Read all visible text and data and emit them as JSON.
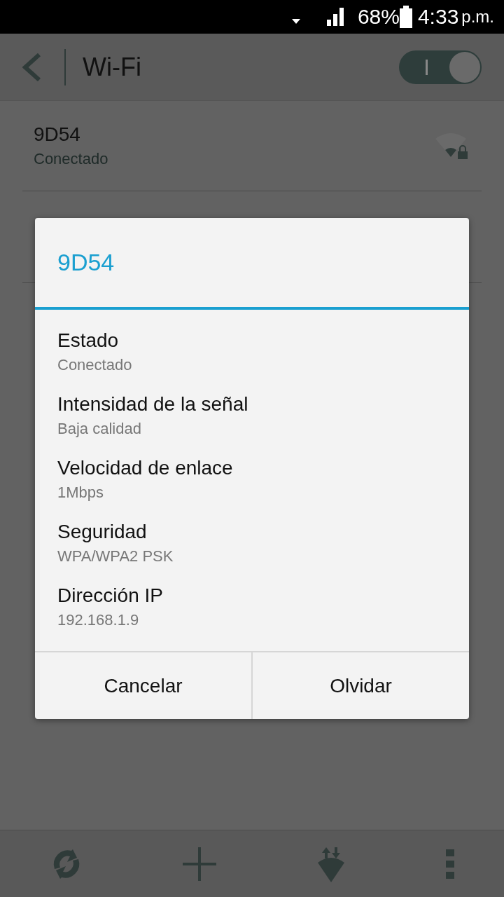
{
  "status_bar": {
    "battery": "68%",
    "time": "4:33",
    "ampm": "p.m."
  },
  "app_bar": {
    "title": "Wi-Fi",
    "wifi_on": true
  },
  "networks": [
    {
      "name": "9D54",
      "status": "Conectado"
    }
  ],
  "dialog": {
    "title": "9D54",
    "details": [
      {
        "label": "Estado",
        "value": "Conectado"
      },
      {
        "label": "Intensidad de la señal",
        "value": "Baja calidad"
      },
      {
        "label": "Velocidad de enlace",
        "value": "1Mbps"
      },
      {
        "label": "Seguridad",
        "value": "WPA/WPA2 PSK"
      },
      {
        "label": "Dirección IP",
        "value": "192.168.1.9"
      }
    ],
    "buttons": [
      "Cancelar",
      "Olvidar"
    ]
  }
}
